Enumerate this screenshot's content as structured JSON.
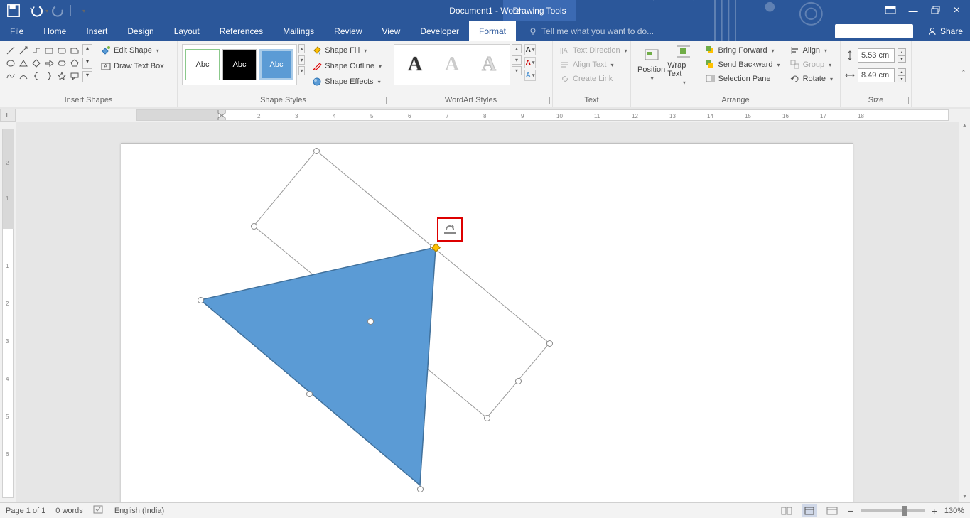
{
  "titlebar": {
    "document_title": "Document1 - Word",
    "context_tab": "Drawing Tools"
  },
  "tabs": {
    "file": "File",
    "home": "Home",
    "insert": "Insert",
    "design": "Design",
    "layout": "Layout",
    "references": "References",
    "mailings": "Mailings",
    "review": "Review",
    "view": "View",
    "developer": "Developer",
    "format": "Format",
    "tell_me_placeholder": "Tell me what you want to do...",
    "share": "Share"
  },
  "ribbon": {
    "insert_shapes": {
      "label": "Insert Shapes",
      "edit_shape": "Edit Shape",
      "draw_text_box": "Draw Text Box"
    },
    "shape_styles": {
      "label": "Shape Styles",
      "thumb_text": "Abc",
      "shape_fill": "Shape Fill",
      "shape_outline": "Shape Outline",
      "shape_effects": "Shape Effects"
    },
    "wordart_styles": {
      "label": "WordArt Styles",
      "thumb_text": "A"
    },
    "text": {
      "label": "Text",
      "text_direction": "Text Direction",
      "align_text": "Align Text",
      "create_link": "Create Link"
    },
    "arrange": {
      "label": "Arrange",
      "position": "Position",
      "wrap_text": "Wrap Text",
      "bring_forward": "Bring Forward",
      "send_backward": "Send Backward",
      "selection_pane": "Selection Pane",
      "align": "Align",
      "group": "Group",
      "rotate": "Rotate"
    },
    "size": {
      "label": "Size",
      "height": "5.53 cm",
      "width": "8.49 cm"
    }
  },
  "statusbar": {
    "page": "Page 1 of 1",
    "words": "0 words",
    "language": "English (India)",
    "zoom": "130%"
  }
}
